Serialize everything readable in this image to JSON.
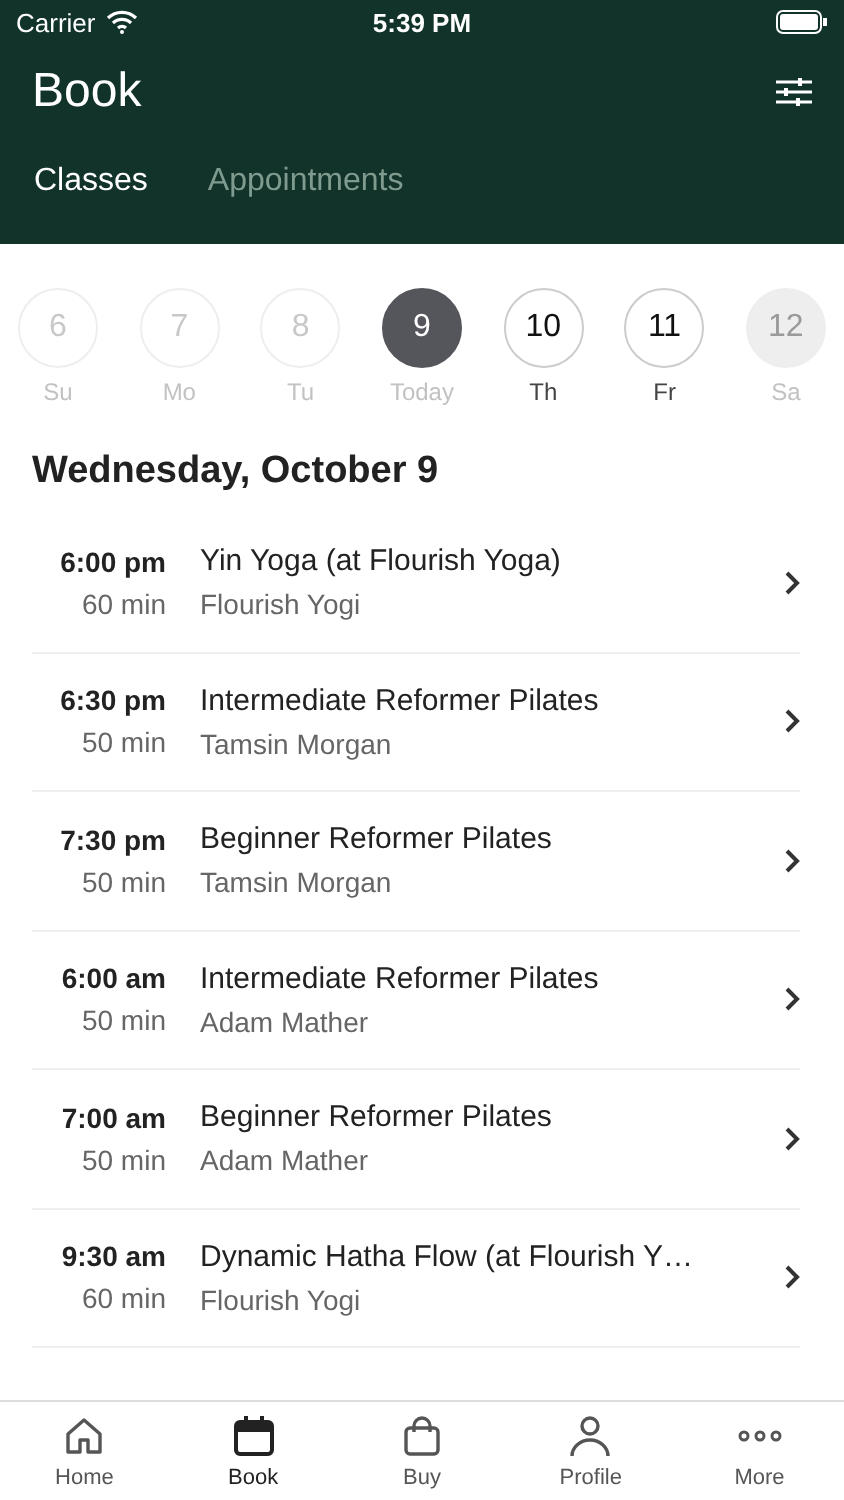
{
  "status_bar": {
    "carrier": "Carrier",
    "time": "5:39 PM"
  },
  "header": {
    "title": "Book"
  },
  "tabs": [
    {
      "label": "Classes",
      "selected": true
    },
    {
      "label": "Appointments",
      "selected": false
    }
  ],
  "days": [
    {
      "number": "6",
      "label": "Su",
      "kind": "past",
      "selected": false
    },
    {
      "number": "7",
      "label": "Mo",
      "kind": "past",
      "selected": false
    },
    {
      "number": "8",
      "label": "Tu",
      "kind": "past",
      "selected": false
    },
    {
      "number": "9",
      "label": "Today",
      "kind": "past",
      "selected": true
    },
    {
      "number": "10",
      "label": "Th",
      "kind": "available",
      "selected": false
    },
    {
      "number": "11",
      "label": "Fr",
      "kind": "available",
      "selected": false
    },
    {
      "number": "12",
      "label": "Sa",
      "kind": "unavailable",
      "selected": false
    }
  ],
  "date_heading": "Wednesday, October 9",
  "classes": [
    {
      "time": "6:00 pm",
      "duration": "60 min",
      "name": "Yin Yoga (at Flourish Yoga)",
      "instructor": "Flourish Yogi"
    },
    {
      "time": "6:30 pm",
      "duration": "50 min",
      "name": "Intermediate Reformer Pilates",
      "instructor": "Tamsin Morgan"
    },
    {
      "time": "7:30 pm",
      "duration": "50 min",
      "name": "Beginner Reformer Pilates",
      "instructor": "Tamsin Morgan"
    },
    {
      "time": "6:00 am",
      "duration": "50 min",
      "name": "Intermediate Reformer Pilates",
      "instructor": "Adam Mather"
    },
    {
      "time": "7:00 am",
      "duration": "50 min",
      "name": "Beginner Reformer Pilates",
      "instructor": "Adam Mather"
    },
    {
      "time": "9:30 am",
      "duration": "60 min",
      "name": "Dynamic Hatha Flow (at Flourish Y…",
      "instructor": "Flourish Yogi"
    }
  ],
  "tab_bar": [
    {
      "label": "Home",
      "selected": false
    },
    {
      "label": "Book",
      "selected": true
    },
    {
      "label": "Buy",
      "selected": false
    },
    {
      "label": "Profile",
      "selected": false
    },
    {
      "label": "More",
      "selected": false
    }
  ]
}
